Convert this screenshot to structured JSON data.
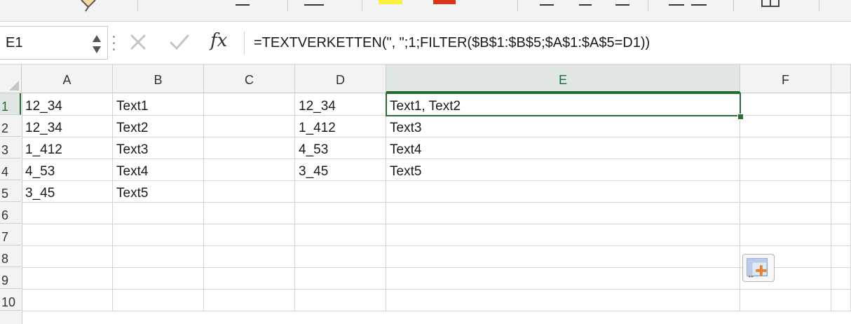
{
  "ribbon": {
    "fill_color": "#fbf33b",
    "font_color": "#d9361f",
    "icons": [
      "format-painter-icon",
      "border-icon",
      "fill-color-icon",
      "font-color-icon",
      "align-icon",
      "cell-styles-icon"
    ]
  },
  "formula_bar": {
    "name_box": "E1",
    "formula": "=TEXTVERKETTEN(\", \";1;FILTER($B$1:$B$5;$A$1:$A$5=D1))"
  },
  "sheet": {
    "columns": [
      "A",
      "B",
      "C",
      "D",
      "E",
      "F"
    ],
    "rows": [
      "1",
      "2",
      "3",
      "4",
      "5",
      "6",
      "7",
      "8",
      "9",
      "10"
    ],
    "active_column": "E",
    "active_row": "1",
    "accent_color": "#2d6a35",
    "cells": [
      [
        "12_34",
        "Text1",
        "",
        "12_34",
        "Text1, Text2",
        ""
      ],
      [
        "12_34",
        "Text2",
        "",
        "1_412",
        "Text3",
        ""
      ],
      [
        "1_412",
        "Text3",
        "",
        "4_53",
        "Text4",
        ""
      ],
      [
        "4_53",
        "Text4",
        "",
        "3_45",
        "Text5",
        ""
      ],
      [
        "3_45",
        "Text5",
        "",
        "",
        "",
        ""
      ],
      [
        "",
        "",
        "",
        "",
        "",
        ""
      ],
      [
        "",
        "",
        "",
        "",
        "",
        ""
      ],
      [
        "",
        "",
        "",
        "",
        "",
        ""
      ],
      [
        "",
        "",
        "",
        "",
        "",
        ""
      ],
      [
        "",
        "",
        "",
        "",
        "",
        ""
      ]
    ]
  }
}
